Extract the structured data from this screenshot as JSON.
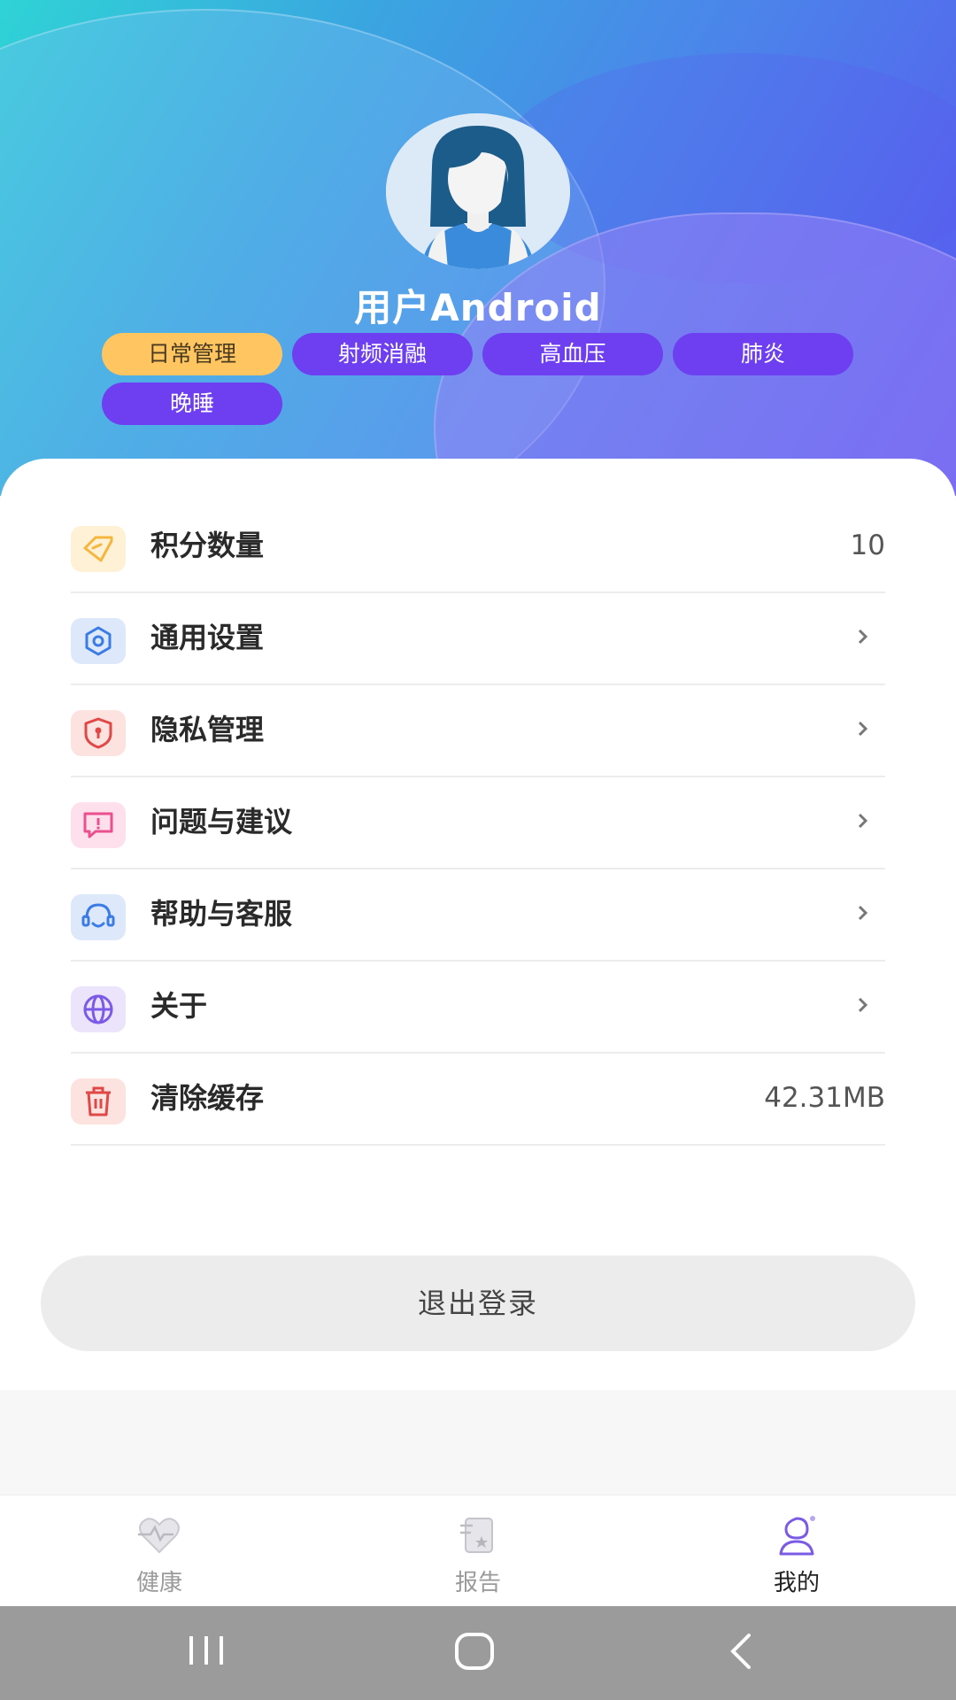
{
  "profile": {
    "username": "用户Android",
    "tags": [
      "日常管理",
      "射频消融",
      "高血压",
      "肺炎",
      "晚睡"
    ]
  },
  "menu": {
    "items": [
      {
        "label": "积分数量",
        "value": "10",
        "icon": "diamond-icon",
        "color": "#f4b63c",
        "bg": "#fff1d6"
      },
      {
        "label": "通用设置",
        "value": "",
        "icon": "settings-icon",
        "color": "#3a7be6",
        "bg": "#dde9fb"
      },
      {
        "label": "隐私管理",
        "value": "",
        "icon": "shield-icon",
        "color": "#e04848",
        "bg": "#fde3e0"
      },
      {
        "label": "问题与建议",
        "value": "",
        "icon": "feedback-icon",
        "color": "#ea4f8e",
        "bg": "#fde0ec"
      },
      {
        "label": "帮助与客服",
        "value": "",
        "icon": "headset-icon",
        "color": "#3a7be6",
        "bg": "#dde9fb"
      },
      {
        "label": "关于",
        "value": "",
        "icon": "globe-icon",
        "color": "#7b5be6",
        "bg": "#ebe4fb"
      },
      {
        "label": "清除缓存",
        "value": "42.31MB",
        "icon": "trash-icon",
        "color": "#e04848",
        "bg": "#fde3e0"
      }
    ]
  },
  "logout_label": "退出登录",
  "tabbar": {
    "tabs": [
      {
        "label": "健康",
        "icon": "heart-icon"
      },
      {
        "label": "报告",
        "icon": "report-icon"
      },
      {
        "label": "我的",
        "icon": "profile-icon"
      }
    ],
    "active": "我的"
  },
  "colors": {
    "accent": "#6d3ff0",
    "tag_active": "#ffc561",
    "header_start": "#2fd3d6",
    "header_end": "#5a55ef"
  }
}
